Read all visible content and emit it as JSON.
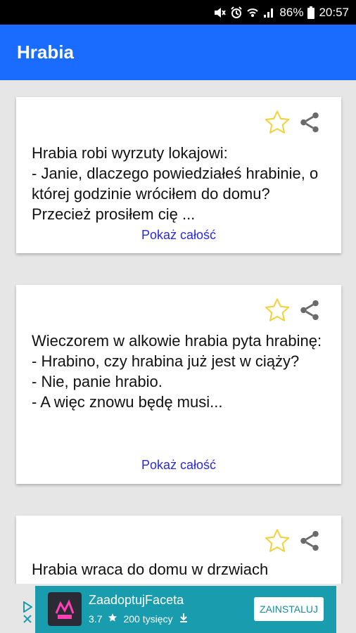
{
  "status_bar": {
    "battery": "86%",
    "time": "20:57",
    "icons": [
      "mute-icon",
      "alarm-icon",
      "wifi-icon",
      "signal-icon",
      "battery-icon"
    ]
  },
  "app_bar": {
    "title": "Hrabia"
  },
  "cards": [
    {
      "text": "Hrabia robi wyrzuty lokajowi:\n- Janie, dlaczego powiedziałeś hrabinie, o której godzinie wróciłem do domu? Przecież prosiłem cię ...",
      "more": "Pokaż całość"
    },
    {
      "text": "Wieczorem w alkowie hrabia pyta hrabinę:\n- Hrabino, czy hrabina już jest w ciąży?\n- Nie, panie hrabio.\n- A więc znowu będę musi...",
      "more": "Pokaż całość"
    },
    {
      "text": "Hrabia wraca do domu w drzwiach"
    }
  ],
  "ad": {
    "app_name": "ZaadoptujFaceta",
    "rating": "3.7",
    "installs": "200 tysięcy",
    "install_label": "ZAINSTALUJ"
  },
  "colors": {
    "app_bar": "#1a6bff",
    "link": "#2a2ad6",
    "ad_background": "#1a9caf",
    "star_outline": "#f2d23a"
  }
}
